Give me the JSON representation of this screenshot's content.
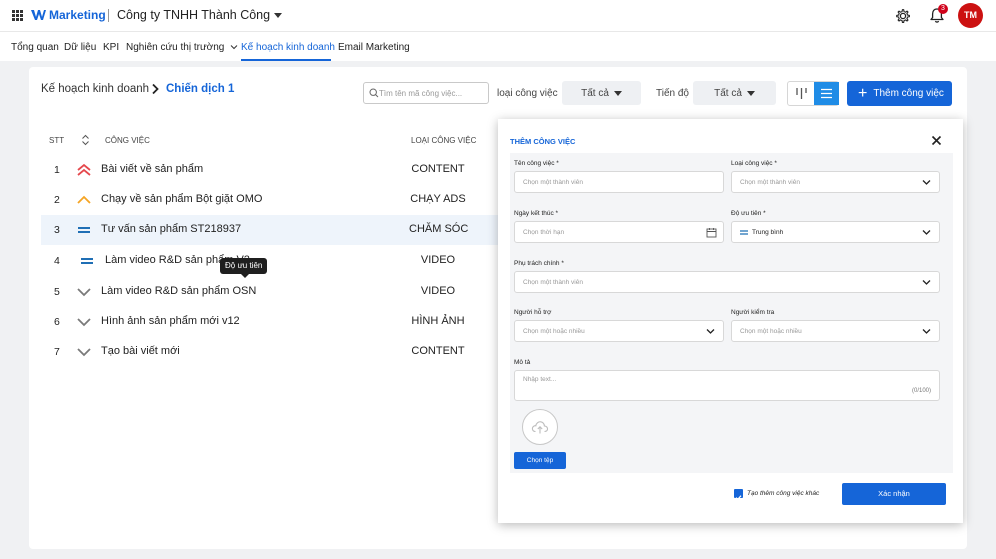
{
  "header": {
    "brand": "Marketing",
    "company": "Công ty TNHH Thành Công",
    "notification_count": "3",
    "avatar_initials": "TM"
  },
  "nav": {
    "items": [
      "Tổng quan",
      "Dữ liệu",
      "KPI",
      "Nghiên cứu thị trường",
      "Kế hoạch kinh doanh",
      "Email Marketing"
    ],
    "active": "Kế hoạch kinh doanh"
  },
  "breadcrumb": {
    "parent": "Kế hoạch kinh doanh",
    "current": "Chiến dịch 1"
  },
  "toolbar": {
    "search_placeholder": "Tìm tên mã công việc...",
    "type_label": "loại công việc",
    "type_value": "Tất cả",
    "progress_label": "Tiến độ",
    "progress_value": "Tất cả",
    "add_button": "Thêm công việc"
  },
  "table": {
    "headers": {
      "stt": "STT",
      "task": "CÔNG VIỆC",
      "type": "LOẠI CÔNG VIỆC"
    },
    "rows": [
      {
        "stt": "1",
        "name": "Bài viết về sản phẩm",
        "type": "CONTENT",
        "priority": "highest-icon"
      },
      {
        "stt": "2",
        "name": "Chạy về sản phẩm Bột giặt OMO",
        "type": "CHẠY ADS",
        "priority": "high-icon"
      },
      {
        "stt": "3",
        "name": "Tư vấn sản phẩm ST218937",
        "type": "CHĂM SÓC",
        "priority": "medium-icon"
      },
      {
        "stt": "4",
        "name": "Làm video R&D sản phẩm V2",
        "type": "VIDEO",
        "priority": "medium-icon"
      },
      {
        "stt": "5",
        "name": "Làm video R&D sản phẩm OSN",
        "type": "VIDEO",
        "priority": "low-icon"
      },
      {
        "stt": "6",
        "name": "Hình ảnh sản phẩm mới v12",
        "type": "HÌNH ẢNH",
        "priority": "low-icon"
      },
      {
        "stt": "7",
        "name": "Tạo bài viết mới",
        "type": "CONTENT",
        "priority": "low-icon"
      }
    ],
    "tooltip": "Độ ưu tiên"
  },
  "modal": {
    "title": "THÊM CÔNG VIỆC",
    "task_name_label": "Tên công việc *",
    "task_name_placeholder": "Chọn một thành viên",
    "task_type_label": "Loại công việc *",
    "task_type_placeholder": "Chọn một thành viên",
    "deadline_label": "Ngày kết thúc *",
    "deadline_placeholder": "Chọn thời hạn",
    "priority_label": "Độ ưu tiên *",
    "priority_value": "Trung bình",
    "owner_label": "Phụ trách chính *",
    "owner_placeholder": "Chọn một thành viên",
    "support_label": "Người hỗ trợ",
    "support_placeholder": "Chọn một hoặc nhiều",
    "reviewer_label": "Người kiểm tra",
    "reviewer_placeholder": "Chọn một hoặc nhiều",
    "desc_label": "Mô tả",
    "desc_placeholder": "Nhập text...",
    "desc_counter": "(0/100)",
    "upload_button": "Chọn tệp",
    "create_another_label": "Tạo thêm công việc khác",
    "create_another_checked": true,
    "confirm_button": "Xác nhận"
  },
  "colors": {
    "primary": "#1565d8",
    "avatar": "#cc1111",
    "priority_highest": "#e5484d",
    "priority_high": "#f5a524",
    "priority_medium": "#1f6fb5",
    "priority_low": "#7a7a7a"
  }
}
